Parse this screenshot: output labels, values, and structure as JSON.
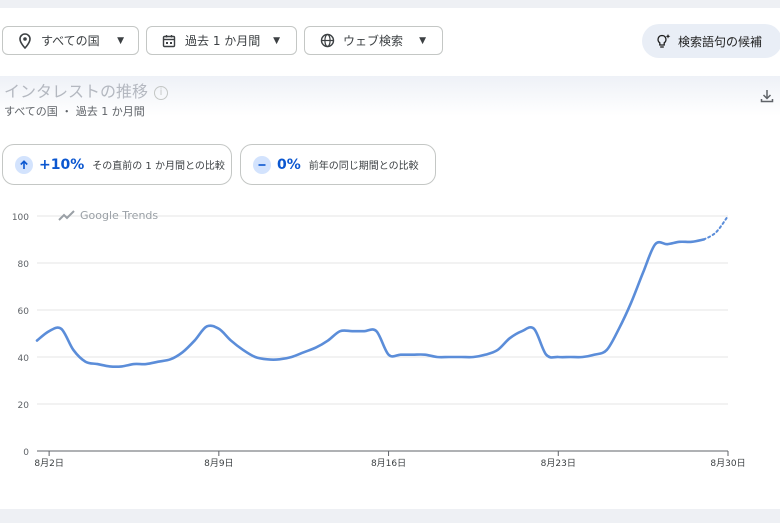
{
  "filters": {
    "country": "すべての国",
    "period": "過去 1 か月間",
    "search_type": "ウェブ検索"
  },
  "suggest_button": "検索語句の候補",
  "card": {
    "title": "インタレストの推移",
    "subtitle": "すべての国 ・ 過去 1 か月間"
  },
  "comparisons": [
    {
      "value": "+10%",
      "label": "その直前の 1 か月間との比較",
      "icon": "arrow-up-icon"
    },
    {
      "value": "0%",
      "label": "前年の同じ期間との比較",
      "icon": "minus-icon"
    }
  ],
  "brand": "Google Trends",
  "colors": {
    "line": "#5b8dd9",
    "grid": "#e6e6e6",
    "accent": "#0b57d0"
  },
  "chart_data": {
    "type": "line",
    "title": "",
    "xlabel": "",
    "ylabel": "",
    "ylim": [
      0,
      100
    ],
    "yticks": [
      0,
      20,
      40,
      60,
      80,
      100
    ],
    "x_ticks": [
      {
        "day": 2,
        "label": "8月2日"
      },
      {
        "day": 9,
        "label": "8月9日"
      },
      {
        "day": 16,
        "label": "8月16日"
      },
      {
        "day": 23,
        "label": "8月23日"
      },
      {
        "day": 30,
        "label": "8月30日"
      }
    ],
    "grid": true,
    "series": [
      {
        "x": [
          1.5,
          2,
          2.5,
          3,
          3.5,
          4,
          4.5,
          5,
          5.5,
          6,
          6.5,
          7,
          7.5,
          8,
          8.5,
          9,
          9.5,
          10,
          10.5,
          11,
          11.5,
          12,
          12.5,
          13,
          13.5,
          14,
          14.5,
          15,
          15.5,
          16,
          16.5,
          17,
          17.5,
          18,
          18.5,
          19,
          19.5,
          20,
          20.5,
          21,
          21.5,
          22,
          22.5,
          23,
          23.5,
          24,
          24.5,
          25,
          25.5,
          26,
          26.5,
          27,
          27.5,
          28,
          28.5,
          29
        ],
        "values": [
          47,
          51,
          52,
          43,
          38,
          37,
          36,
          36,
          37,
          37,
          38,
          39,
          42,
          47,
          53,
          52,
          47,
          43,
          40,
          39,
          39,
          40,
          42,
          44,
          47,
          51,
          51,
          51,
          51,
          41,
          41,
          41,
          41,
          40,
          40,
          40,
          40,
          41,
          43,
          48,
          51,
          52,
          41,
          40,
          40,
          40,
          41,
          43,
          52,
          63,
          76,
          88,
          88,
          89,
          89,
          90
        ],
        "style": "solid"
      },
      {
        "x": [
          29,
          29.5,
          30
        ],
        "values": [
          90,
          93,
          100
        ],
        "style": "dotted"
      }
    ]
  }
}
